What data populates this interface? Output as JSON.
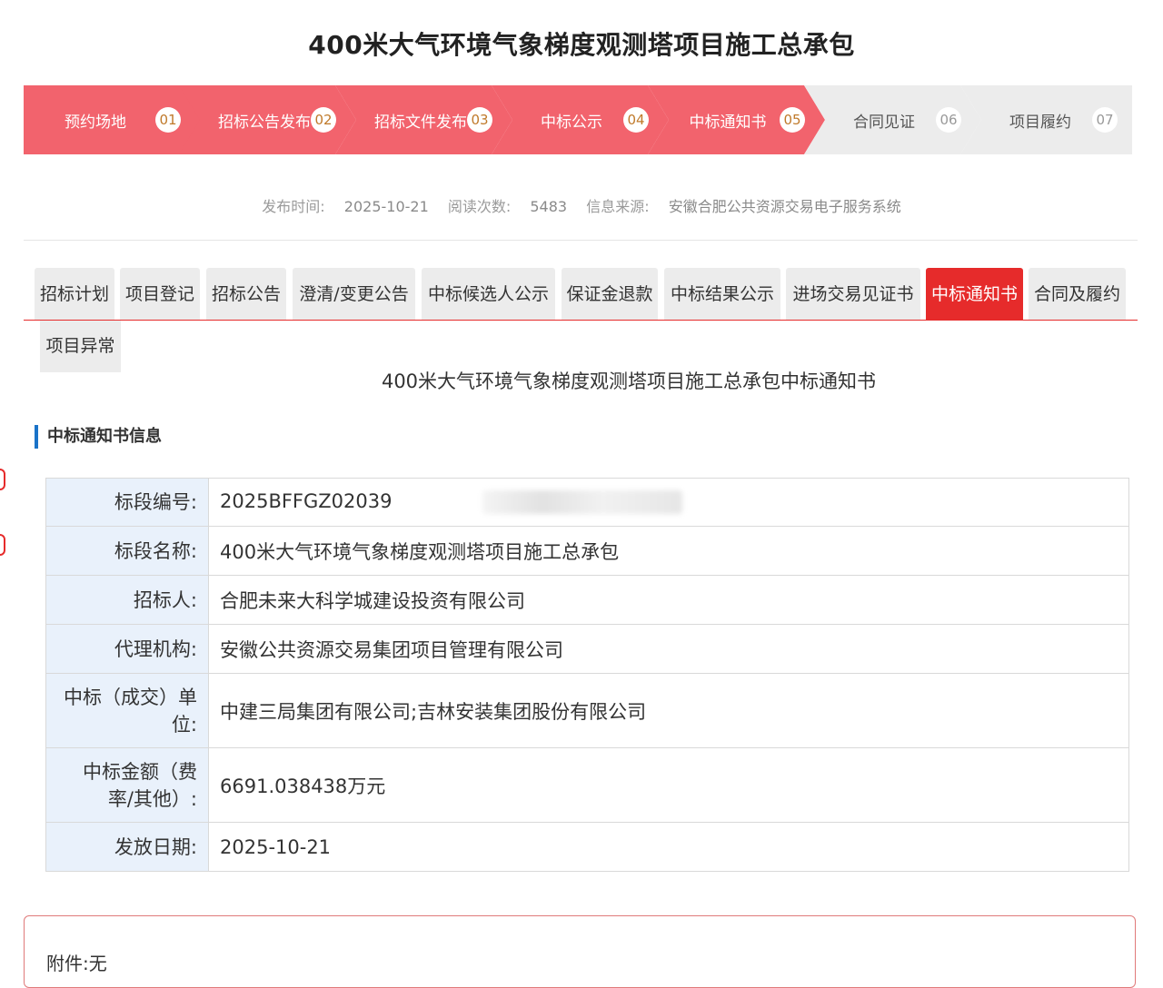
{
  "page": {
    "title": "400米大气环境气象梯度观测塔项目施工总承包"
  },
  "steps": [
    {
      "label": "预约场地",
      "num": "01",
      "state": "done"
    },
    {
      "label": "招标公告发布",
      "num": "02",
      "state": "done"
    },
    {
      "label": "招标文件发布",
      "num": "03",
      "state": "done"
    },
    {
      "label": "中标公示",
      "num": "04",
      "state": "done"
    },
    {
      "label": "中标通知书",
      "num": "05",
      "state": "done"
    },
    {
      "label": "合同见证",
      "num": "06",
      "state": "todo"
    },
    {
      "label": "项目履约",
      "num": "07",
      "state": "todo"
    }
  ],
  "meta": {
    "publish_label": "发布时间:",
    "publish_value": "2025-10-21",
    "reads_label": "阅读次数:",
    "reads_value": "5483",
    "source_label": "信息来源:",
    "source_value": "安徽合肥公共资源交易电子服务系统"
  },
  "tabs": [
    {
      "label": "招标计划",
      "active": false
    },
    {
      "label": "项目登记",
      "active": false
    },
    {
      "label": "招标公告",
      "active": false
    },
    {
      "label": "澄清/变更公告",
      "active": false
    },
    {
      "label": "中标候选人公示",
      "active": false
    },
    {
      "label": "保证金退款",
      "active": false
    },
    {
      "label": "中标结果公示",
      "active": false
    },
    {
      "label": "进场交易见证书",
      "active": false
    },
    {
      "label": "中标通知书",
      "active": true
    },
    {
      "label": "合同及履约",
      "active": false
    },
    {
      "label": "项目异常",
      "active": false
    }
  ],
  "notice": {
    "title": "400米大气环境气象梯度观测塔项目施工总承包中标通知书",
    "section_title": "中标通知书信息"
  },
  "info_rows": [
    {
      "key": "标段编号:",
      "value": "2025BFFGZ02039"
    },
    {
      "key": "标段名称:",
      "value": "400米大气环境气象梯度观测塔项目施工总承包"
    },
    {
      "key": "招标人:",
      "value": "合肥未来大科学城建设投资有限公司"
    },
    {
      "key": "代理机构:",
      "value": "安徽公共资源交易集团项目管理有限公司"
    },
    {
      "key": "中标（成交）单位:",
      "value": "中建三局集团有限公司;吉林安装集团股份有限公司"
    },
    {
      "key": "中标金额（费率/其他）:",
      "value": "6691.038438万元"
    },
    {
      "key": "发放日期:",
      "value": "2025-10-21"
    }
  ],
  "attachment": {
    "text": "附件:无"
  },
  "colors": {
    "step_done": "#f2636d",
    "step_todo": "#ececec",
    "tab_active": "#e62b2b",
    "key_cell": "#e9f1fb",
    "section_accent": "#1a73c8"
  }
}
